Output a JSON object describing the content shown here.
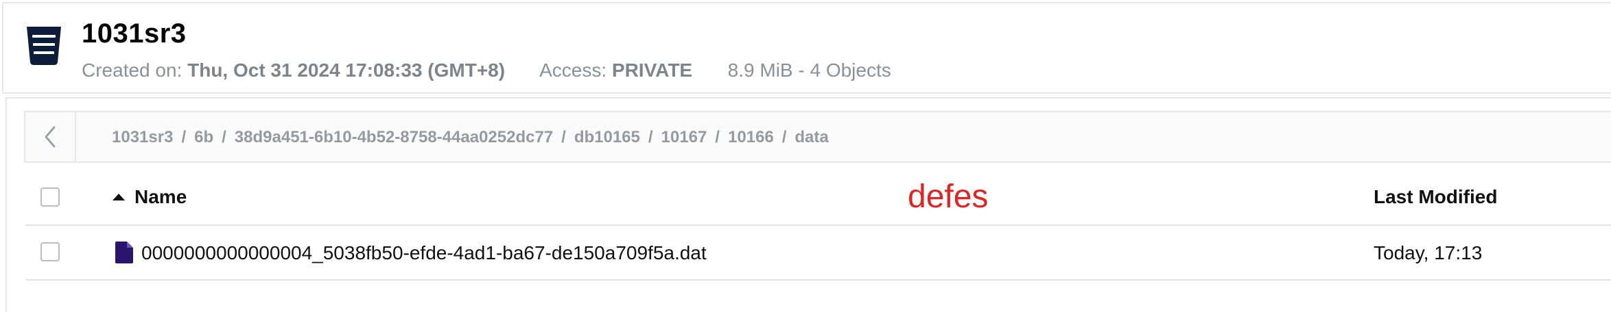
{
  "bucket": {
    "name": "1031sr3",
    "created_label": "Created on:",
    "created_value": "Thu, Oct 31 2024 17:08:33 (GMT+8)",
    "access_label": "Access:",
    "access_value": "PRIVATE",
    "size_summary": "8.9 MiB - 4 Objects"
  },
  "breadcrumbs": [
    "1031sr3",
    "6b",
    "38d9a451-6b10-4b52-8758-44aa0252dc77",
    "db10165",
    "10167",
    "10166",
    "data"
  ],
  "breadcrumb_separator": "/",
  "table": {
    "columns": {
      "name": "Name",
      "last_modified": "Last Modified"
    },
    "rows": [
      {
        "name": "0000000000000004_5038fb50-efde-4ad1-ba67-de150a709f5a.dat",
        "last_modified": "Today, 17:13"
      }
    ]
  },
  "overlay_label": "defes",
  "colors": {
    "icon_navy": "#0c1d3c",
    "file_icon_purple": "#2a1670",
    "overlay_red": "#e02424"
  }
}
